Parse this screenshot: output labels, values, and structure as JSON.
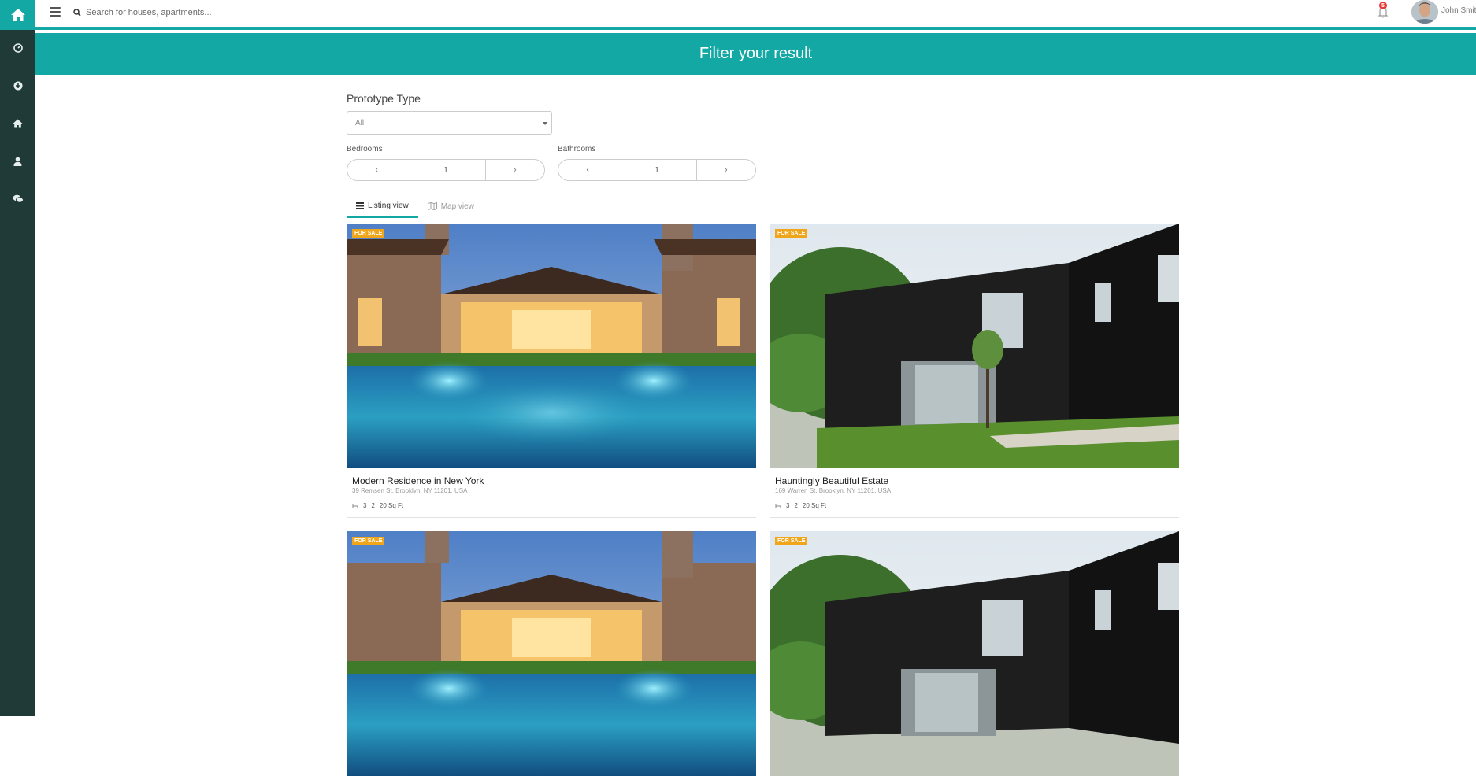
{
  "topbar": {
    "search_placeholder": "Search for houses, apartments...",
    "notification_count": "5",
    "user_name": "John Smith"
  },
  "sidebar": {
    "items": [
      {
        "icon": "dashboard-icon"
      },
      {
        "icon": "add-circle-icon"
      },
      {
        "icon": "home-icon"
      },
      {
        "icon": "user-icon"
      },
      {
        "icon": "chat-icon"
      }
    ]
  },
  "banner": {
    "title": "Filter your result"
  },
  "filters": {
    "prototype_label": "Prototype Type",
    "prototype_value": "All",
    "bedrooms_label": "Bedrooms",
    "bedrooms_value": "1",
    "bathrooms_label": "Bathrooms",
    "bathrooms_value": "1",
    "prev_glyph": "‹",
    "next_glyph": "›"
  },
  "tabs": [
    {
      "label": "Listing view",
      "active": true
    },
    {
      "label": "Map view",
      "active": false
    }
  ],
  "listings": [
    {
      "tag": "FOR SALE",
      "title": "Modern Residence in New York",
      "address": "39 Remsen St, Brooklyn, NY 11201, USA",
      "beds": "3",
      "baths": "2",
      "area": "20 Sq Ft"
    },
    {
      "tag": "FOR SALE",
      "title": "Hauntingly Beautiful Estate",
      "address": "169 Warren St, Brooklyn, NY 11201, USA",
      "beds": "3",
      "baths": "2",
      "area": "20 Sq Ft"
    },
    {
      "tag": "FOR SALE",
      "title": "",
      "address": "",
      "beds": "",
      "baths": "",
      "area": ""
    },
    {
      "tag": "FOR SALE",
      "title": "",
      "address": "",
      "beds": "",
      "baths": "",
      "area": ""
    }
  ],
  "colors": {
    "accent": "#14a8a4",
    "sidebar": "#1f3a37",
    "tag": "#f0a61a",
    "badge": "#e53935"
  }
}
